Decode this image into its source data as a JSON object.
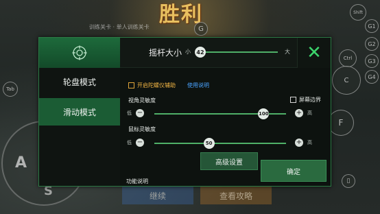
{
  "background": {
    "victory_text": "胜利",
    "caption": "训练关卡 · 单人训练关卡",
    "icons": {
      "g_top": "G",
      "shift": "Shift",
      "tab_left": "Tab",
      "g1": "G1",
      "g2": "G2",
      "g3": "G3",
      "g4": "G4",
      "ctrl": "Ctrl",
      "c": "C",
      "f": "F",
      "a": "A",
      "s": "S"
    },
    "bottom_buttons": {
      "continue": "继续",
      "view_detail": "查看攻略"
    }
  },
  "dialog": {
    "header": {
      "joystick_size_label": "摇杆大小",
      "min_label": "小",
      "max_label": "大",
      "joystick_size_value": "42",
      "close_symbol": "✕"
    },
    "sidebar": {
      "items": [
        {
          "label": "轮盘模式",
          "active": false
        },
        {
          "label": "滑动模式",
          "active": true
        }
      ]
    },
    "gyro_checkbox_label": "开启陀螺仪辅助",
    "usage_link": "使用说明",
    "screen_border_label": "屏幕边界",
    "view_sensitivity": {
      "label": "视角灵敏度",
      "low": "低",
      "high": "高",
      "value": "100",
      "fraction": 1.0
    },
    "mouse_sensitivity": {
      "label": "鼠标灵敏度",
      "low": "低",
      "high": "高",
      "value": "50",
      "fraction": 0.5
    },
    "minus_symbol": "−",
    "plus_symbol": "+",
    "advanced_button": "高级设置",
    "ok_button": "确定",
    "function_link": "功能说明"
  },
  "colors": {
    "accent_green": "#3cd46c",
    "active_tab": "#1b5c34",
    "checkbox_gold": "#f2b544",
    "link_blue": "#4aa3ff"
  }
}
